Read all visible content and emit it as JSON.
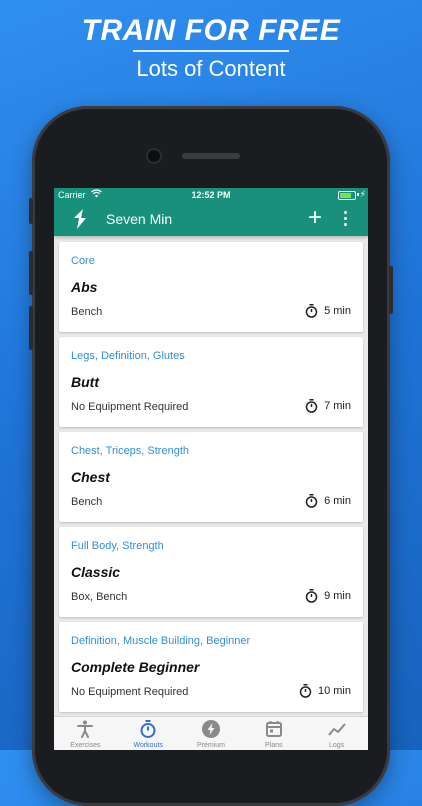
{
  "promo": {
    "title": "TRAIN FOR FREE",
    "subtitle": "Lots of Content"
  },
  "status_bar": {
    "carrier": "Carrier",
    "time": "12:52 PM"
  },
  "app_bar": {
    "title": "Seven Min",
    "add_icon": "plus-icon",
    "menu_icon": "more-vertical-icon"
  },
  "workouts": [
    {
      "tags": "Core",
      "name": "Abs",
      "equipment": "Bench",
      "duration": "5 min"
    },
    {
      "tags": "Legs, Definition, Glutes",
      "name": "Butt",
      "equipment": "No Equipment Required",
      "duration": "7 min"
    },
    {
      "tags": "Chest, Triceps, Strength",
      "name": "Chest",
      "equipment": "Bench",
      "duration": "6 min"
    },
    {
      "tags": "Full Body, Strength",
      "name": "Classic",
      "equipment": "Box, Bench",
      "duration": "9 min"
    },
    {
      "tags": "Definition, Muscle Building, Beginner",
      "name": "Complete Beginner",
      "equipment": "No Equipment Required",
      "duration": "10 min"
    }
  ],
  "nav": [
    {
      "label": "Exercises",
      "icon": "person-icon",
      "active": false
    },
    {
      "label": "Workouts",
      "icon": "stopwatch-icon",
      "active": true
    },
    {
      "label": "Premium",
      "icon": "bolt-icon",
      "active": false
    },
    {
      "label": "Plans",
      "icon": "calendar-icon",
      "active": false
    },
    {
      "label": "Logs",
      "icon": "chart-line-icon",
      "active": false
    }
  ],
  "colors": {
    "accent": "#18907c",
    "tag_text": "#2f8fd8",
    "nav_active": "#2f6fd0",
    "background": "#1f73d6"
  }
}
